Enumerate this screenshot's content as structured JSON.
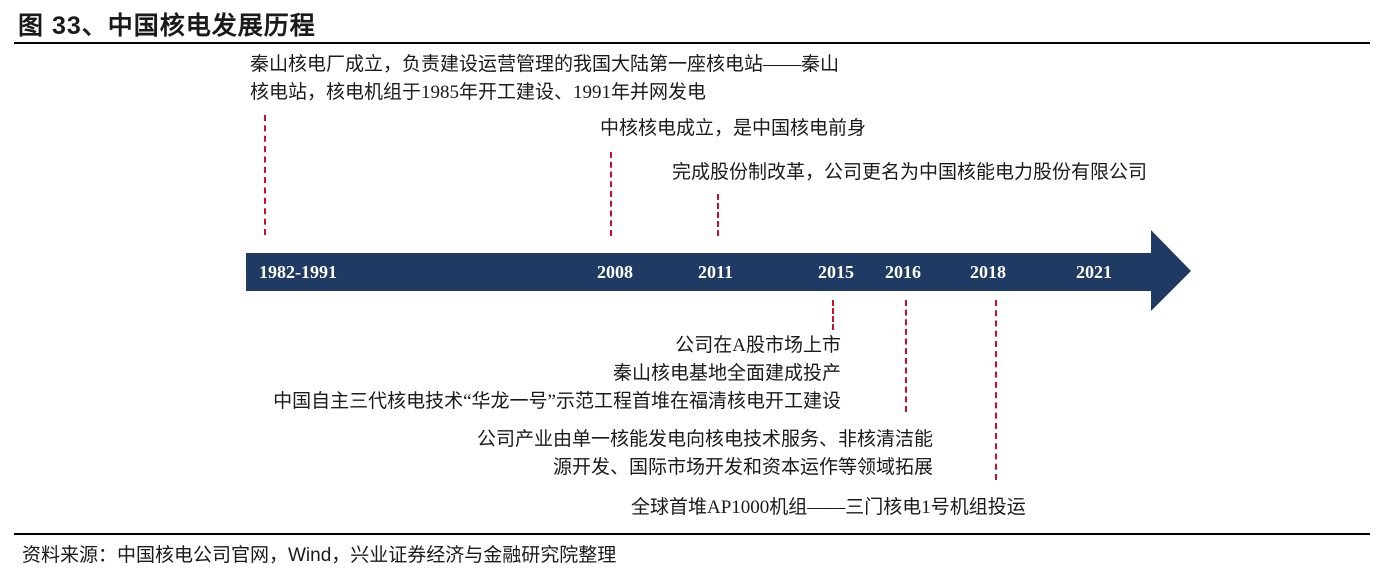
{
  "title": "图 33、中国核电发展历程",
  "timeline": {
    "years": [
      "1982-1991",
      "2008",
      "2011",
      "2015",
      "2016",
      "2018",
      "2021"
    ]
  },
  "events_above": [
    {
      "year": "1982-1991",
      "lines": [
        "秦山核电厂成立，负责建设运营管理的我国大陆第一座核电站——秦山",
        "核电站，核电机组于1985年开工建设、1991年并网发电"
      ]
    },
    {
      "year": "2008",
      "lines": [
        "中核核电成立，是中国核电前身"
      ]
    },
    {
      "year": "2011",
      "lines": [
        "完成股份制改革，公司更名为中国核能电力股份有限公司"
      ]
    }
  ],
  "events_below": [
    {
      "year": "2015",
      "lines": [
        "公司在A股市场上市",
        "秦山核电基地全面建成投产",
        "中国自主三代核电技术“华龙一号”示范工程首堆在福清核电开工建设"
      ]
    },
    {
      "year": "2016",
      "lines": [
        "公司产业由单一核能发电向核电技术服务、非核清洁能",
        "源开发、国际市场开发和资本运作等领域拓展"
      ]
    },
    {
      "year": "2018",
      "lines": [
        "全球首堆AP1000机组——三门核电1号机组投运"
      ]
    }
  ],
  "source": "资料来源：中国核电公司官网，Wind，兴业证券经济与金融研究院整理",
  "colors": {
    "arrow": "#1f3b63",
    "dash": "#c8102e",
    "text": "#1a1a1a"
  }
}
